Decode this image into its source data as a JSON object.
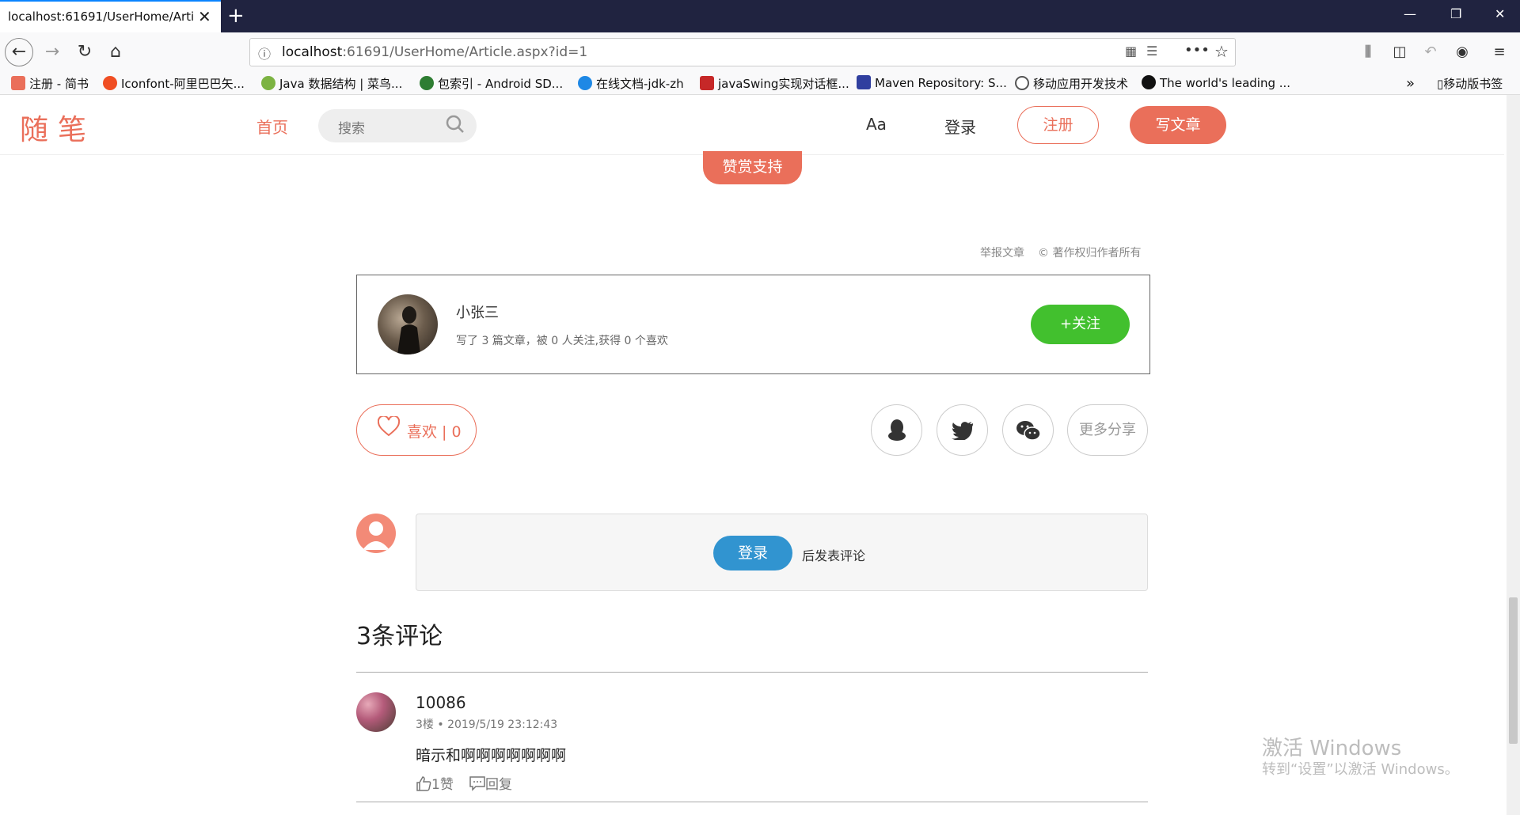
{
  "browser": {
    "tab_title": "localhost:61691/UserHome/Artic",
    "url_host": "localhost",
    "url_rest": ":61691/UserHome/Article.aspx?id=1",
    "bookmarks": [
      {
        "label": "注册 - 简书",
        "color": "#ea6f5a"
      },
      {
        "label": "Iconfont-阿里巴巴矢...",
        "color": "#f04e23"
      },
      {
        "label": "Java 数据结构 | 菜鸟...",
        "color": "#7cb342"
      },
      {
        "label": "包索引 - Android SD...",
        "color": "#2e7d32"
      },
      {
        "label": "在线文档-jdk-zh",
        "color": "#1e88e5"
      },
      {
        "label": "javaSwing实现对话框...",
        "color": "#c62828"
      },
      {
        "label": "Maven Repository: S...",
        "color": "#303f9f"
      },
      {
        "label": "移动应用开发技术",
        "color": "#555555"
      },
      {
        "label": "The world's leading ...",
        "color": "#111111"
      }
    ],
    "mobile_bookmarks": "移动版书签"
  },
  "header": {
    "logo": "随笔",
    "nav_home": "首页",
    "search_placeholder": "搜索",
    "font_toggle": "Aa",
    "login": "登录",
    "register": "注册",
    "write": "写文章"
  },
  "article": {
    "reward_button": "赞赏支持",
    "report": "举报文章",
    "copyright": "© 著作权归作者所有"
  },
  "author": {
    "name": "小张三",
    "meta": "写了 3 篇文章，被 0 人关注,获得 0 个喜欢",
    "follow": "+关注"
  },
  "actions": {
    "like": "喜欢 | 0",
    "share_more": "更多分享"
  },
  "comment_box": {
    "login_button": "登录",
    "after_text": "后发表评论"
  },
  "comments": {
    "title": "3条评论",
    "items": [
      {
        "user": "10086",
        "meta": "3楼 • 2019/5/19 23:12:43",
        "text": "暗示和啊啊啊啊啊啊啊",
        "like": "1赞",
        "reply": "回复"
      }
    ]
  },
  "watermark": {
    "line1": "激活 Windows",
    "line2": "转到“设置”以激活 Windows。"
  },
  "colors": {
    "accent": "#ea6f5a",
    "follow_green": "#42c02e",
    "login_blue": "#3194d0"
  }
}
